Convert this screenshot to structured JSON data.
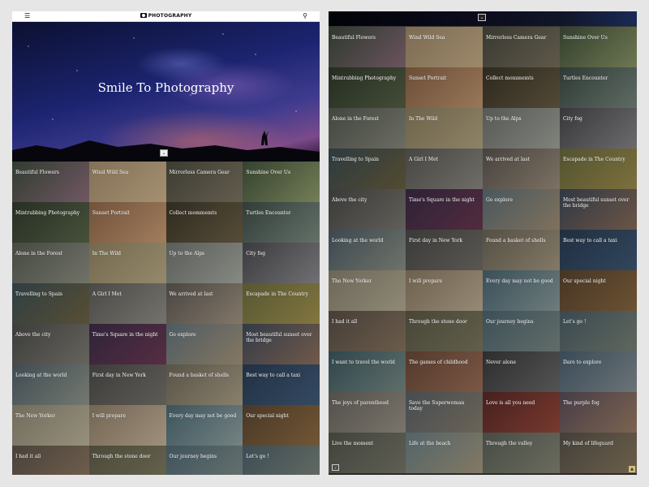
{
  "brand": {
    "name": "PHOTOGRAPHY"
  },
  "hero": {
    "title": "Smile To Photography"
  },
  "icons": {
    "menu": "hamburger-menu-icon",
    "search": "search-icon",
    "scroll_down": "chevron-down-icon",
    "scroll_up": "chevron-up-icon",
    "logo": "camera-icon"
  },
  "left_tiles": [
    {
      "label": "Beautiful Flowers",
      "c1": "#3b4a3a",
      "c2": "#8a6b7a"
    },
    {
      "label": "Wind Wild Sea",
      "c1": "#a08a6a",
      "c2": "#c9b08a"
    },
    {
      "label": "Mirrorless Camera Gear",
      "c1": "#4a4a3e",
      "c2": "#7a7260"
    },
    {
      "label": "Sunshine Over Us",
      "c1": "#40503a",
      "c2": "#8e9a6a"
    },
    {
      "label": "Mintrubbing Photography",
      "c1": "#2f3a2c",
      "c2": "#586347"
    },
    {
      "label": "Sunset Portrait",
      "c1": "#8a6448",
      "c2": "#c59a72"
    },
    {
      "label": "Collect mommemts",
      "c1": "#3a3528",
      "c2": "#6a5e44"
    },
    {
      "label": "Turtles Encounter",
      "c1": "#3c4a44",
      "c2": "#7a8a80"
    },
    {
      "label": "Alone in the Forest",
      "c1": "#555a50",
      "c2": "#8a8c80"
    },
    {
      "label": "In The Wild",
      "c1": "#8c8060",
      "c2": "#b7a883"
    },
    {
      "label": "Up to the Alps",
      "c1": "#6e726c",
      "c2": "#a5a8a0"
    },
    {
      "label": "City fog",
      "c1": "#48484c",
      "c2": "#8a8a8e"
    },
    {
      "label": "Travelling to Spain",
      "c1": "#3a4c52",
      "c2": "#6b6040"
    },
    {
      "label": "A Girl I Met",
      "c1": "#5a5a56",
      "c2": "#8f8c84"
    },
    {
      "label": "We arrived at last",
      "c1": "#5a5650",
      "c2": "#a09280"
    },
    {
      "label": "Escapade in The Country",
      "c1": "#6a6a3e",
      "c2": "#a0904e"
    },
    {
      "label": "Above the city",
      "c1": "#4a4a48",
      "c2": "#7c7a72"
    },
    {
      "label": "Time's Square in the night",
      "c1": "#3a2c48",
      "c2": "#6a3850"
    },
    {
      "label": "Go explore",
      "c1": "#5e7078",
      "c2": "#a49278"
    },
    {
      "label": "Most beautiful sunset over the bridge",
      "c1": "#3e4858",
      "c2": "#8a6e5a"
    },
    {
      "label": "Looking at the world",
      "c1": "#4e5c66",
      "c2": "#8e9488"
    },
    {
      "label": "First day in New York",
      "c1": "#4a4a48",
      "c2": "#74706a"
    },
    {
      "label": "Found a basket of shells",
      "c1": "#6c6658",
      "c2": "#a89c84"
    },
    {
      "label": "Best way to call a taxi",
      "c1": "#2a3c52",
      "c2": "#405a78"
    },
    {
      "label": "The New Yorker",
      "c1": "#8a8470",
      "c2": "#b8b098"
    },
    {
      "label": "I will prepare",
      "c1": "#8c7c64",
      "c2": "#c2b098"
    },
    {
      "label": "Every day may not be good",
      "c1": "#4a6672",
      "c2": "#8ea0a0"
    },
    {
      "label": "Our special night",
      "c1": "#5a4430",
      "c2": "#8a6a40"
    },
    {
      "label": "I had it all",
      "c1": "#5a5048",
      "c2": "#8a7660"
    },
    {
      "label": "Through the stone door",
      "c1": "#5c5a48",
      "c2": "#7e7a60"
    },
    {
      "label": "Our journey begins",
      "c1": "#4e6670",
      "c2": "#7e8c88"
    },
    {
      "label": "Let's go !",
      "c1": "#4a5e68",
      "c2": "#7c8478"
    }
  ],
  "right_tiles": [
    {
      "label": "Beautiful Flowers",
      "c1": "#3b4a3a",
      "c2": "#8a6b7a"
    },
    {
      "label": "Wind Wild Sea",
      "c1": "#a08a6a",
      "c2": "#c9b08a"
    },
    {
      "label": "Mirrorless Camera Gear",
      "c1": "#4a4a3e",
      "c2": "#7a7260"
    },
    {
      "label": "Sunshine Over Us",
      "c1": "#40503a",
      "c2": "#8e9a6a"
    },
    {
      "label": "Mintrubbing Photography",
      "c1": "#2f3a2c",
      "c2": "#586347"
    },
    {
      "label": "Sunset Portrait",
      "c1": "#8a6448",
      "c2": "#c59a72"
    },
    {
      "label": "Collect mommemts",
      "c1": "#3a3528",
      "c2": "#6a5e44"
    },
    {
      "label": "Turtles Encounter",
      "c1": "#3c4a44",
      "c2": "#7a8a80"
    },
    {
      "label": "Alone in the Forest",
      "c1": "#555a50",
      "c2": "#8a8c80"
    },
    {
      "label": "In The Wild",
      "c1": "#8c8060",
      "c2": "#b7a883"
    },
    {
      "label": "Up to the Alps",
      "c1": "#6e726c",
      "c2": "#a5a8a0"
    },
    {
      "label": "City fog",
      "c1": "#48484c",
      "c2": "#8a8a8e"
    },
    {
      "label": "Travelling to Spain",
      "c1": "#3a4c52",
      "c2": "#6b6040"
    },
    {
      "label": "A Girl I Met",
      "c1": "#5a5a56",
      "c2": "#8f8c84"
    },
    {
      "label": "We arrived at last",
      "c1": "#5a5650",
      "c2": "#a09280"
    },
    {
      "label": "Escapade in The Country",
      "c1": "#6a6a3e",
      "c2": "#a0904e"
    },
    {
      "label": "Above the city",
      "c1": "#4a4a48",
      "c2": "#7c7a72"
    },
    {
      "label": "Time's Square in the night",
      "c1": "#3a2c48",
      "c2": "#6a3850"
    },
    {
      "label": "Go explore",
      "c1": "#5e7078",
      "c2": "#a49278"
    },
    {
      "label": "Most beautiful sunset over the bridge",
      "c1": "#3e4858",
      "c2": "#8a6e5a"
    },
    {
      "label": "Looking at the world",
      "c1": "#4e5c66",
      "c2": "#8e9488"
    },
    {
      "label": "First day in New York",
      "c1": "#4a4a48",
      "c2": "#74706a"
    },
    {
      "label": "Found a basket of shells",
      "c1": "#6c6658",
      "c2": "#a89c84"
    },
    {
      "label": "Best way to call a taxi",
      "c1": "#2a3c52",
      "c2": "#405a78"
    },
    {
      "label": "The New Yorker",
      "c1": "#8a8470",
      "c2": "#b8b098"
    },
    {
      "label": "I will prepare",
      "c1": "#8c7c64",
      "c2": "#c2b098"
    },
    {
      "label": "Every day may not be good",
      "c1": "#4a6672",
      "c2": "#8ea0a0"
    },
    {
      "label": "Our special night",
      "c1": "#5a4430",
      "c2": "#8a6a40"
    },
    {
      "label": "I had it all",
      "c1": "#5a5048",
      "c2": "#8a7660"
    },
    {
      "label": "Through the stone door",
      "c1": "#5c5a48",
      "c2": "#7e7a60"
    },
    {
      "label": "Our journey begins",
      "c1": "#4e6670",
      "c2": "#7e8c88"
    },
    {
      "label": "Let's go !",
      "c1": "#4a5e68",
      "c2": "#7c8478"
    },
    {
      "label": "I want to travel the world",
      "c1": "#3e5a62",
      "c2": "#7a8e88"
    },
    {
      "label": "The games of childhood",
      "c1": "#6a4a38",
      "c2": "#a0705a"
    },
    {
      "label": "Never alone",
      "c1": "#3a3a3a",
      "c2": "#6c6c6c"
    },
    {
      "label": "Dare to explore",
      "c1": "#4a6070",
      "c2": "#8a9498"
    },
    {
      "label": "The joys of parenthood",
      "c1": "#6a6660",
      "c2": "#9c968a"
    },
    {
      "label": "Save the Superwoman today",
      "c1": "#5a6268",
      "c2": "#8a8070"
    },
    {
      "label": "Love is all you need",
      "c1": "#5a2a28",
      "c2": "#9a4a3c"
    },
    {
      "label": "The purple fog",
      "c1": "#5a4e5a",
      "c2": "#a08068"
    },
    {
      "label": "Live the moment",
      "c1": "#54564c",
      "c2": "#7a7a6c"
    },
    {
      "label": "Life at the beach",
      "c1": "#6a8088",
      "c2": "#a89c80"
    },
    {
      "label": "Through the valley",
      "c1": "#5a6258",
      "c2": "#8a8a78"
    },
    {
      "label": "My kind of lifeguard",
      "c1": "#56524a",
      "c2": "#8a7a60"
    }
  ]
}
